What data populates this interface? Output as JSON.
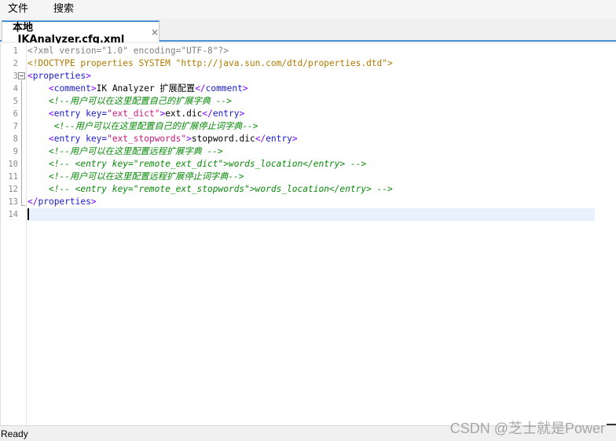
{
  "menu": {
    "items": [
      {
        "label": "文件"
      },
      {
        "label": "搜索"
      }
    ]
  },
  "tab": {
    "label": "本地_IKAnalyzer.cfg.xml",
    "close_glyph": "×"
  },
  "editor": {
    "line_numbers": [
      "1",
      "2",
      "3",
      "4",
      "5",
      "6",
      "7",
      "8",
      "9",
      "10",
      "11",
      "12",
      "13",
      "14"
    ],
    "lines": [
      {
        "pi": "<?xml version=\"1.0\" encoding=\"UTF-8\"?>"
      },
      {
        "doctype": "<!DOCTYPE properties SYSTEM \"http://java.sun.com/dtd/properties.dtd\">"
      },
      {
        "open": "<",
        "name": "properties",
        "close": ">"
      },
      {
        "indent": "    ",
        "open": "<",
        "name": "comment",
        "close": ">",
        "text": "IK Analyzer 扩展配置",
        "end_open": "</",
        "end_name": "comment",
        "end_close": ">"
      },
      {
        "indent": "    ",
        "comment": "<!--用户可以在这里配置自己的扩展字典 -->"
      },
      {
        "indent": "    ",
        "open": "<",
        "name": "entry",
        "attr": " key=",
        "value": "\"ext_dict\"",
        "close": ">",
        "text": "ext.dic",
        "end_open": "</",
        "end_name": "entry",
        "end_close": ">"
      },
      {
        "indent": "     ",
        "comment": "<!--用户可以在这里配置自己的扩展停止词字典-->"
      },
      {
        "indent": "    ",
        "open": "<",
        "name": "entry",
        "attr": " key=",
        "value": "\"ext_stopwords\"",
        "close": ">",
        "text": "stopword.dic",
        "end_open": "</",
        "end_name": "entry",
        "end_close": ">"
      },
      {
        "indent": "    ",
        "comment": "<!--用户可以在这里配置远程扩展字典 -->"
      },
      {
        "indent": "    ",
        "comment": "<!-- <entry key=\"remote_ext_dict\">words_location</entry> -->"
      },
      {
        "indent": "    ",
        "comment": "<!--用户可以在这里配置远程扩展停止词字典-->"
      },
      {
        "indent": "    ",
        "comment": "<!-- <entry key=\"remote_ext_stopwords\">words_location</entry> -->"
      },
      {
        "end_open": "</",
        "end_name": "properties",
        "end_close": ">"
      },
      {}
    ]
  },
  "status": {
    "text": "Ready"
  },
  "watermark": "CSDN @芝士就是Power"
}
